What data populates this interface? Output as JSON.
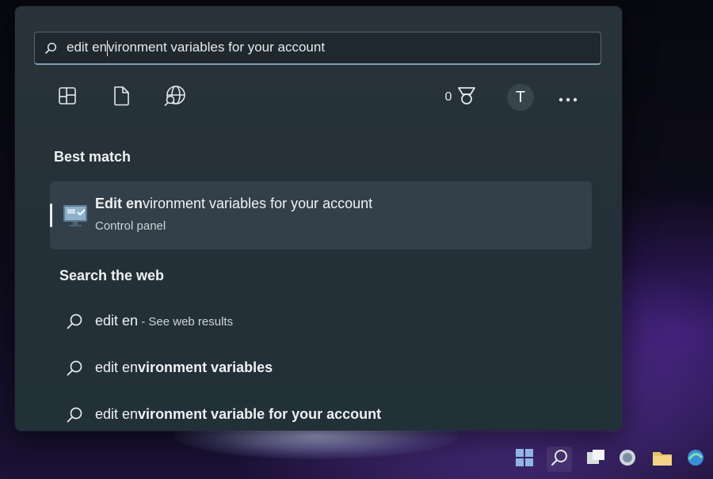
{
  "search": {
    "typed_prefix": "edit en",
    "typed_rest": "vironment variables for your account"
  },
  "toolbar": {
    "icons": [
      "apps-icon",
      "documents-icon",
      "web-icon"
    ],
    "rewards_points": "0",
    "avatar_initial": "T"
  },
  "best_match": {
    "heading": "Best match",
    "title_bold": "Edit en",
    "title_rest": "vironment variables for your account",
    "subtitle": "Control panel"
  },
  "web": {
    "heading": "Search the web",
    "items": [
      {
        "text_bold": "edit en",
        "text_rest": "",
        "hint": " - See web results"
      },
      {
        "text_bold": "edit en",
        "text_rest": "vironment variables",
        "hint": ""
      },
      {
        "text_bold": "edit en",
        "text_rest": "vironment variable for your account",
        "hint": ""
      }
    ]
  },
  "colors": {
    "panel": "#28333a",
    "best_match_bg": "#33404a",
    "accent_underline": "#7fa0b3"
  }
}
